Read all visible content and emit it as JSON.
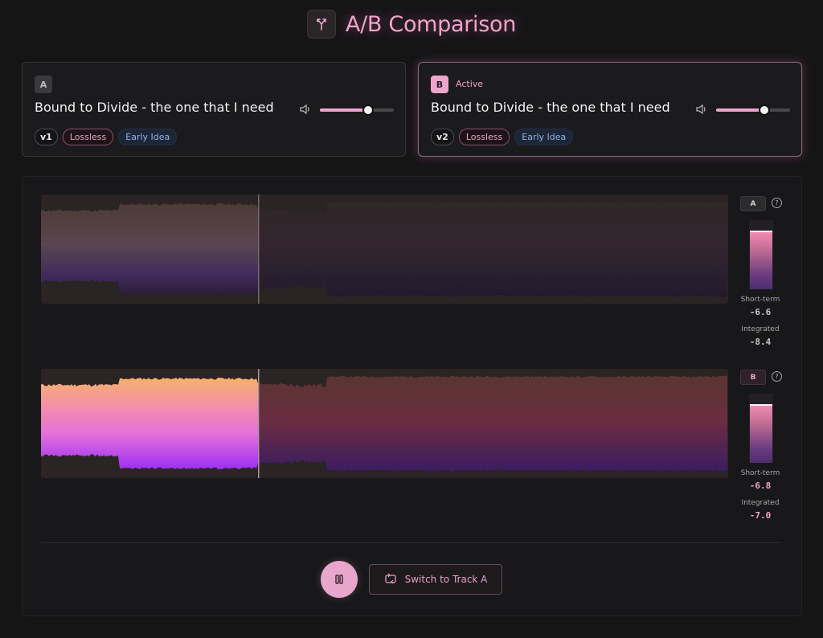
{
  "header": {
    "title": "A/B Comparison",
    "logo_icon": "split-arrows-icon"
  },
  "tracks": [
    {
      "badge": "A",
      "active_label": "",
      "title": "Bound to Divide - the one that I need",
      "volume": 0.65,
      "version": "v1",
      "tags": [
        "Lossless",
        "Early Idea"
      ],
      "meter": {
        "label": "A",
        "short_term_label": "Short-term",
        "short_term": "-6.6",
        "integrated_label": "Integrated",
        "integrated": "-8.4",
        "level": 0.82,
        "peak": 0.83
      }
    },
    {
      "badge": "B",
      "active_label": "Active",
      "title": "Bound to Divide - the one that I need",
      "volume": 0.65,
      "version": "v2",
      "tags": [
        "Lossless",
        "Early Idea"
      ],
      "meter": {
        "label": "B",
        "short_term_label": "Short-term",
        "short_term": "-6.8",
        "integrated_label": "Integrated",
        "integrated": "-7.0",
        "level": 0.83,
        "peak": 0.83
      }
    }
  ],
  "playback": {
    "progress": 0.316,
    "state": "playing",
    "pause_icon": "pause-icon"
  },
  "controls": {
    "switch_label": "Switch to Track A",
    "switch_icon": "switch-track-icon"
  },
  "colors": {
    "accent": "#f0a4cc",
    "background": "#161516",
    "tag_blue": "#8fb4ea"
  }
}
